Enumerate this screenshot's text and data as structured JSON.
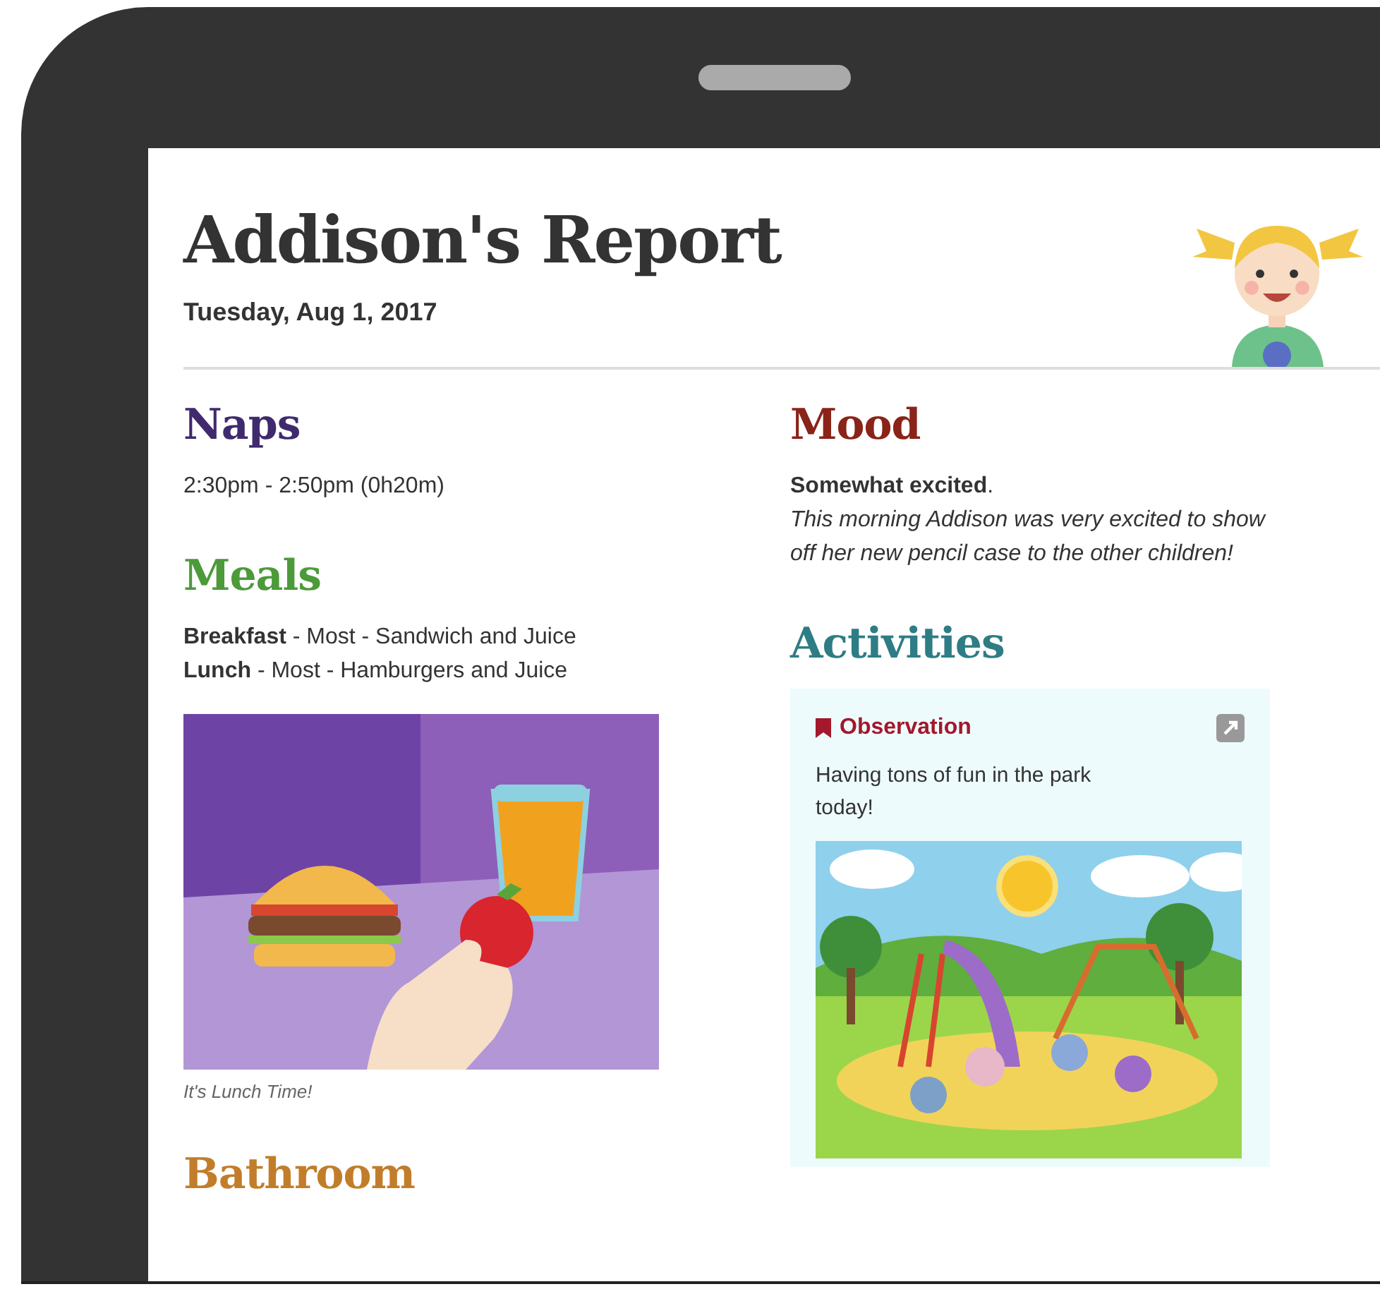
{
  "header": {
    "title": "Addison's Report",
    "date": "Tuesday, Aug 1, 2017"
  },
  "columns": [
    [
      {
        "kind": "text",
        "title": "Naps",
        "color": "#3f2a6e",
        "text": "2:30pm - 2:50pm (0h20m)"
      },
      {
        "kind": "meals",
        "title": "Meals",
        "color": "#4c9a3a",
        "items": [
          "**Breakfast** - Most - Sandwich and Juice",
          "**Lunch** - Most - Hamburgers and Juice"
        ],
        "caption": "It's Lunch Time!"
      },
      {
        "kind": "heading",
        "title": "Bathroom",
        "color": "#c27d2a"
      }
    ],
    [
      {
        "kind": "mood",
        "title": "Mood",
        "color": "#8a2318",
        "summary": "**Somewhat excited**.",
        "note": "This morning Addison was very excited to show off her new pencil case to the other children!"
      },
      {
        "kind": "activities",
        "title": "Activities",
        "color": "#2e7d85",
        "cards": [
          {
            "label": "Observation",
            "text": "Having tons of fun in the park today!"
          }
        ]
      }
    ]
  ]
}
